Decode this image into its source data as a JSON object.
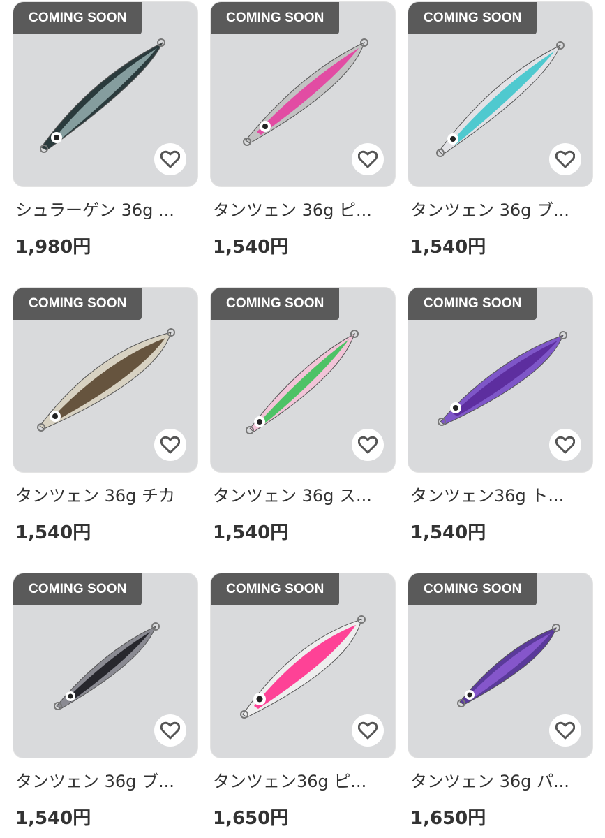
{
  "badge_label": "COMING SOON",
  "products": [
    {
      "title": "シュラーゲン 36g ...",
      "price": "1,980円",
      "colors": [
        "#8fa8a8",
        "#c9c2d6",
        "#2a3a3c"
      ]
    },
    {
      "title": "タンツェン 36g ピ...",
      "price": "1,540円",
      "colors": [
        "#e63fa0",
        "#f2d24a",
        "#c2c2c2"
      ]
    },
    {
      "title": "タンツェン 36g ブ...",
      "price": "1,540円",
      "colors": [
        "#3fc6cc",
        "#7fb6e8",
        "#e2e2e6"
      ]
    },
    {
      "title": "タンツェン 36g チカ",
      "price": "1,540円",
      "colors": [
        "#5a4630",
        "#a89570",
        "#d8d2c2"
      ]
    },
    {
      "title": "タンツェン 36g ス...",
      "price": "1,540円",
      "colors": [
        "#3cc25a",
        "#e8459a",
        "#f2c4d8"
      ]
    },
    {
      "title": "タンツェン36g ト...",
      "price": "1,540円",
      "colors": [
        "#5a2a9a",
        "#a04ad8",
        "#7e56c8"
      ]
    },
    {
      "title": "タンツェン 36g ブ...",
      "price": "1,540円",
      "colors": [
        "#1c1c22",
        "#3a3a44",
        "#8a8a92"
      ]
    },
    {
      "title": "タンツェン36g ピ...",
      "price": "1,650円",
      "colors": [
        "#ff2f8c",
        "#ff6fb0",
        "#eeeeee"
      ]
    },
    {
      "title": "タンツェン 36g パ...",
      "price": "1,650円",
      "colors": [
        "#8a5ad0",
        "#c8c8d2",
        "#5a3a9a"
      ]
    }
  ]
}
